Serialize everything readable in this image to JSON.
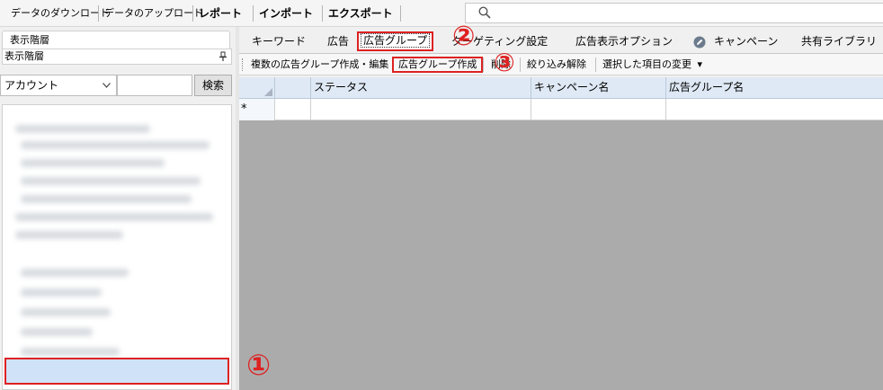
{
  "toolbar": {
    "download": "データのダウンロード",
    "upload": "データのアップロード",
    "report": "レポート",
    "import": "インポート",
    "export": "エクスポート"
  },
  "search": {
    "placeholder": ""
  },
  "left_pane": {
    "tab_label": "表示階層",
    "header_label": "表示階層",
    "account_select": "アカウント",
    "search_button": "検索"
  },
  "tabs": {
    "keyword": "キーワード",
    "ad": "広告",
    "adgroup": "広告グループ",
    "targeting": "ターゲティング設定",
    "ad_options": "広告表示オプション",
    "campaign": "キャンペーン",
    "shared_library": "共有ライブラリ"
  },
  "actions": {
    "bulk_create": "複数の広告グループ作成・編集",
    "create": "広告グループ作成",
    "delete": "削除",
    "clear_filter": "絞り込み解除",
    "change_selected": "選択した項目の変更",
    "dropdown_arrow": "▾"
  },
  "grid": {
    "columns": [
      "ステータス",
      "キャンペーン名",
      "広告グループ名"
    ],
    "new_row_marker": "*"
  },
  "annotations": {
    "one": "①",
    "two": "②",
    "three": "③"
  },
  "colors": {
    "highlight": "#dd2222",
    "grid_header": "#dfe9f5",
    "selection": "#cfe2f7"
  }
}
